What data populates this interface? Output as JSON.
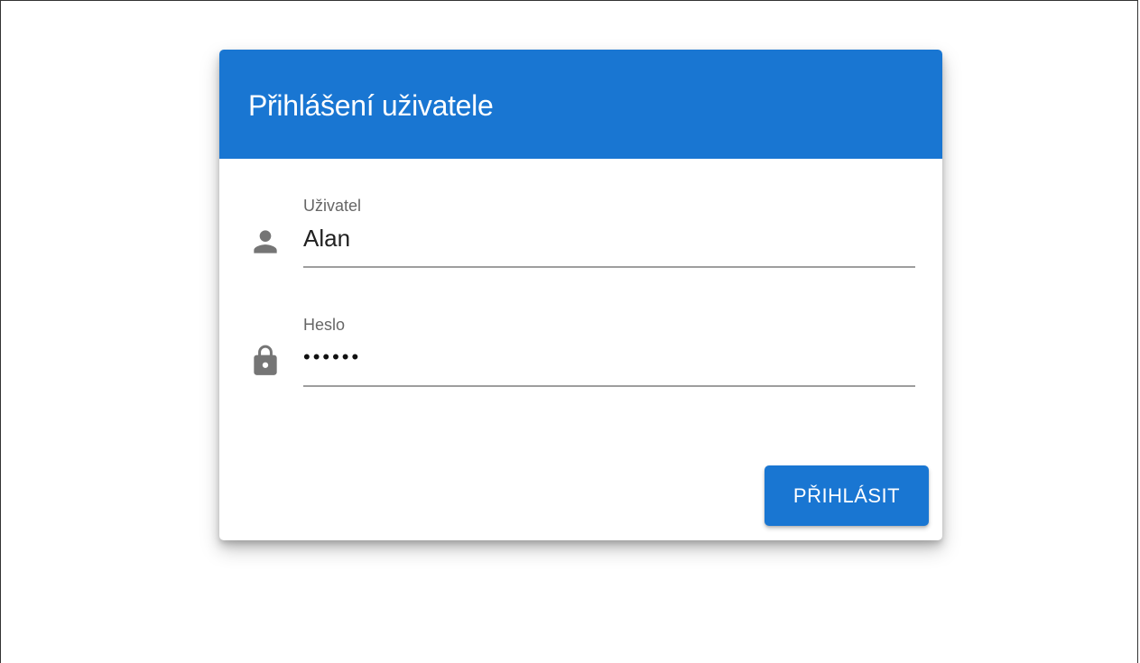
{
  "login_dialog": {
    "title": "Přihlášení uživatele",
    "header_color": "#1976d2",
    "username": {
      "label": "Uživatel",
      "value": "Alan",
      "icon": "person-icon"
    },
    "password": {
      "label": "Heslo",
      "value": "••••••",
      "icon": "lock-icon"
    },
    "submit_label": "PŘIHLÁSIT",
    "button_color": "#1976d2"
  }
}
